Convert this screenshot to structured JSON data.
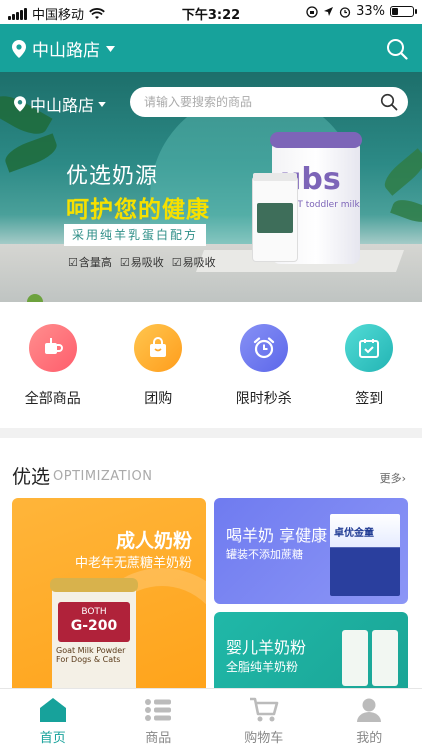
{
  "status_bar": {
    "carrier": "中国移动",
    "time": "下午3:22",
    "battery": "33%",
    "battery_level": 0.33
  },
  "nav": {
    "location": "中山路店"
  },
  "banner": {
    "location": "中山路店",
    "search_placeholder": "请输入要搜索的商品",
    "slogan_line1": "优选奶源",
    "slogan_line2": "呵护您的健康",
    "slogan_line3": "采用纯羊乳蛋白配方",
    "features": [
      "含量高",
      "易吸收",
      "易吸收"
    ],
    "product_big_brand": "ubs",
    "product_big_tag": "GOAT toddler milk"
  },
  "categories": [
    {
      "label": "全部商品",
      "icon": "cup-icon",
      "color": "#ff6f6f"
    },
    {
      "label": "团购",
      "icon": "shopping-bag-icon",
      "color": "#ffb531"
    },
    {
      "label": "限时秒杀",
      "icon": "alarm-clock-icon",
      "color": "#6d78f0"
    },
    {
      "label": "签到",
      "icon": "calendar-check-icon",
      "color": "#33c6c6"
    }
  ],
  "section": {
    "title": "优选",
    "subtitle": "OPTIMIZATION",
    "more": "更多"
  },
  "cards": {
    "adult": {
      "title": "成人奶粉",
      "subtitle": "中老年无蔗糖羊奶粉",
      "tin_brand": "BOTH",
      "tin_model": "G-200",
      "tin_line1": "Goat Milk Powder",
      "tin_line2": "For Dogs & Cats"
    },
    "goat": {
      "title": "喝羊奶 享健康",
      "subtitle": "罐装不添加蔗糖",
      "box_label": "卓优金童"
    },
    "infant": {
      "title": "婴儿羊奶粉",
      "subtitle": "全脂纯羊奶粉"
    }
  },
  "tabs": [
    {
      "label": "首页",
      "icon": "home-icon",
      "active": true
    },
    {
      "label": "商品",
      "icon": "list-icon",
      "active": false
    },
    {
      "label": "购物车",
      "icon": "cart-icon",
      "active": false
    },
    {
      "label": "我的",
      "icon": "user-icon",
      "active": false
    }
  ],
  "colors": {
    "brand": "#17a29b",
    "inactive": "#888888"
  }
}
